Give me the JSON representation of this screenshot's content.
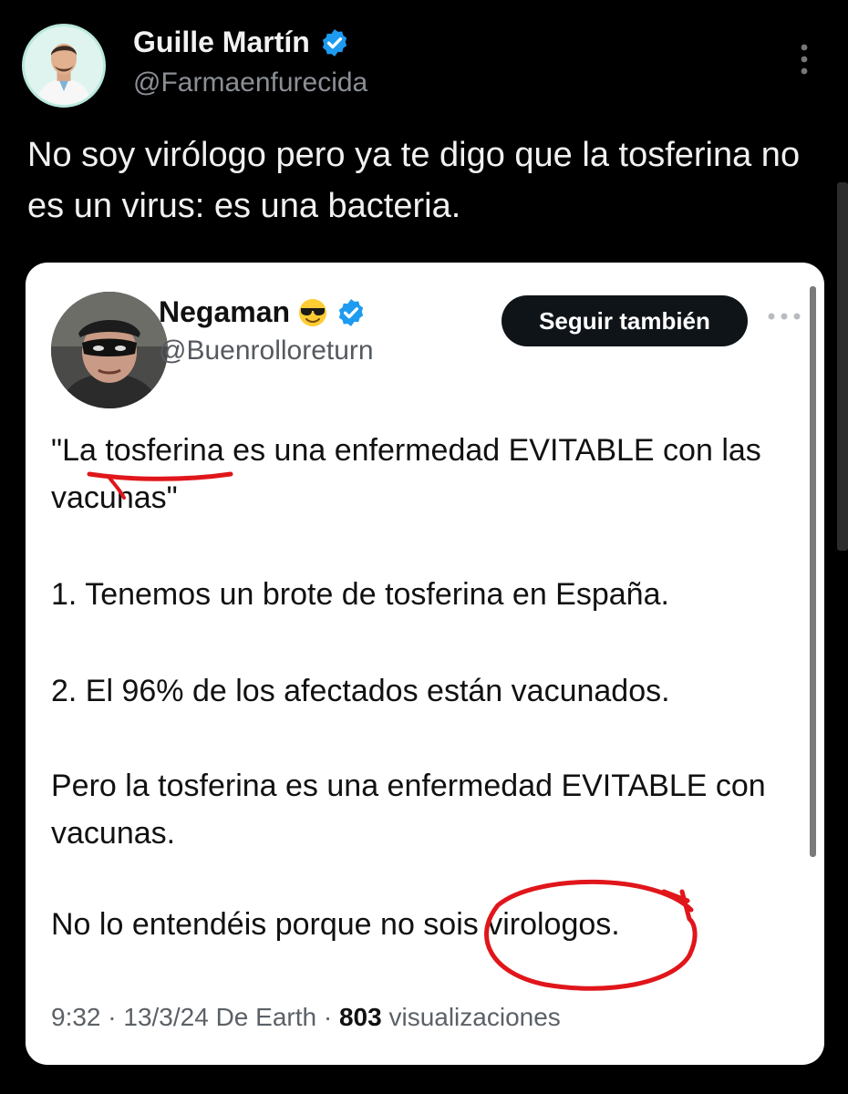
{
  "outer": {
    "name": "Guille Martín",
    "handle": "@Farmaenfurecida",
    "text": "No soy virólogo pero ya te digo que la tosferina no es un virus: es una bacteria."
  },
  "quoted": {
    "name": "Negaman",
    "handle": "@Buenrolloreturn",
    "follow_label": "Seguir también",
    "paragraphs": [
      "\"La tosferina es una enfermedad EVITABLE con las vacunas\"",
      "1. Tenemos un brote de tosferina en España.",
      "2. El 96% de los afectados están vacunados.",
      "Pero la tosferina es una enfermedad EVITABLE con vacunas.",
      "No lo entendéis porque no sois virologos."
    ],
    "meta": {
      "time_date": "9:32 · 13/3/24 De Earth ·",
      "views": "803",
      "views_label": "visualizaciones"
    }
  },
  "icons": {
    "verified": "verified-badge-icon",
    "more": "more-options-icon",
    "emoji": "sunglasses-emoji-icon"
  },
  "colors": {
    "verified_blue": "#1d9bf0",
    "annotation_red": "#e0161b",
    "follow_button_bg": "#0f1419"
  }
}
